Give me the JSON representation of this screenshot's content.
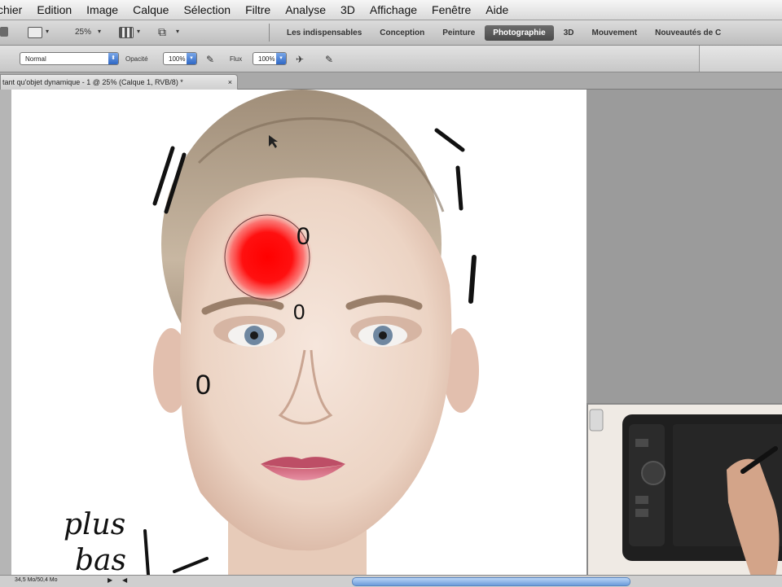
{
  "menubar": {
    "items": [
      "chier",
      "Edition",
      "Image",
      "Calque",
      "Sélection",
      "Filtre",
      "Analyse",
      "3D",
      "Affichage",
      "Fenêtre",
      "Aide"
    ]
  },
  "appbar": {
    "zoom": "25%",
    "workspaces": [
      {
        "label": "Les indispensables",
        "active": false
      },
      {
        "label": "Conception",
        "active": false
      },
      {
        "label": "Peinture",
        "active": false
      },
      {
        "label": "Photographie",
        "active": true
      },
      {
        "label": "3D",
        "active": false
      },
      {
        "label": "Mouvement",
        "active": false
      },
      {
        "label": "Nouveautés de C",
        "active": false
      }
    ]
  },
  "options": {
    "mode_value": "Normal",
    "opacity_label": "Opacité",
    "opacity_value": "100%",
    "flow_label": "Flux",
    "flow_value": "100%"
  },
  "document": {
    "tab_title": "tant qu'objet dynamique - 1 @ 25% (Calque 1, RVB/8) *",
    "close": "×"
  },
  "annotations": {
    "marks": [
      "0",
      "0",
      "0"
    ],
    "handwriting_line1": "plus",
    "handwriting_line2": "bas"
  },
  "statusbar": {
    "doc_size": "34,5 Mo/50,4 Mo"
  },
  "colors": {
    "brush_red": "#ff0000",
    "active_workspace": "#4a4a4a",
    "scroll_thumb": "#6c9ddb"
  }
}
